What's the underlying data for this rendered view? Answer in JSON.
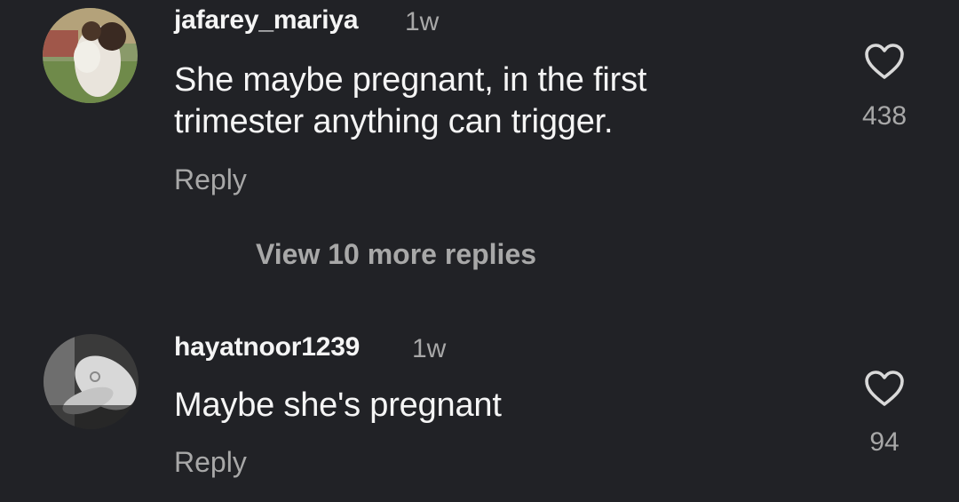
{
  "comments": [
    {
      "username": "jafarey_mariya",
      "time": "1w",
      "text_lines": [
        "She maybe pregnant, in the first",
        "trimester anything can trigger."
      ],
      "reply_label": "Reply",
      "likes": "438",
      "avatar_icon": "profile-photo-mother-child",
      "heart_icon": "heart-outline-icon"
    },
    {
      "username": "hayatnoor1239",
      "time": "1w",
      "text_lines": [
        "Maybe she's pregnant"
      ],
      "reply_label": "Reply",
      "likes": "94",
      "avatar_icon": "profile-photo-hand-ring",
      "heart_icon": "heart-outline-icon"
    }
  ],
  "view_more_replies": "View 10 more replies",
  "colors": {
    "background": "#212226",
    "primary_text": "#f5f5f5",
    "secondary_text": "#a8a8a8"
  }
}
